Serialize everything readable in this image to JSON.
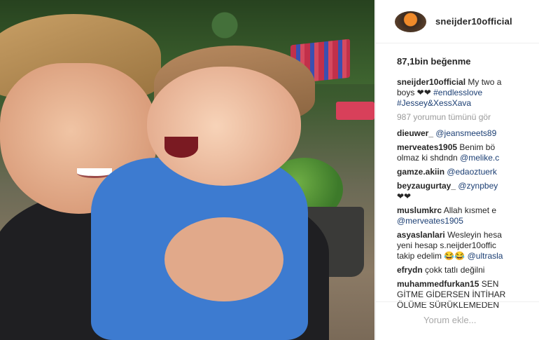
{
  "post": {
    "username": "sneijder10official",
    "likes": "87,1bin beğenme",
    "caption": {
      "user": "sneijder10official",
      "text_line1": "My two a",
      "text_line2": "boys ❤❤ ",
      "tag1": "#endlesslove",
      "tag2": "#Jessey&XessXava"
    },
    "view_all": "987 yorumun tümünü gör",
    "comments": [
      {
        "user": "dieuwer_",
        "text": "",
        "mention": "@jeansmeets89"
      },
      {
        "user": "merveates1905",
        "text": "Benim bö",
        "text2": "olmaz ki shdndn ",
        "mention": "@melike.c"
      },
      {
        "user": "gamze.akiin",
        "text": "",
        "mention": "@edaoztuerk"
      },
      {
        "user": "beyzaugurtay_",
        "text": "",
        "mention": "@zynpbey",
        "text2": "❤❤"
      },
      {
        "user": "muslumkrc",
        "text": "Allah kısmet e",
        "mention": "@merveates1905"
      },
      {
        "user": "asyaslanlari",
        "text": "Wesleyin hesa",
        "text2": "yeni hesap s.neijder10offic",
        "text3": "takip edelim 😂😂 ",
        "mention": "@ultrasla"
      },
      {
        "user": "efrydn",
        "text": "çokk tatlı değilni"
      },
      {
        "user": "muhammedfurkan15",
        "text": "SEN",
        "text2": "GİTME GİDERSEN İNTİHAR",
        "text3": "ÖLÜME SÜRÜKLEMEDEN"
      }
    ],
    "comment_placeholder": "Yorum ekle..."
  },
  "colors": {
    "mention": "#1b3e73",
    "muted": "#9a9a9a",
    "text": "#262626"
  }
}
